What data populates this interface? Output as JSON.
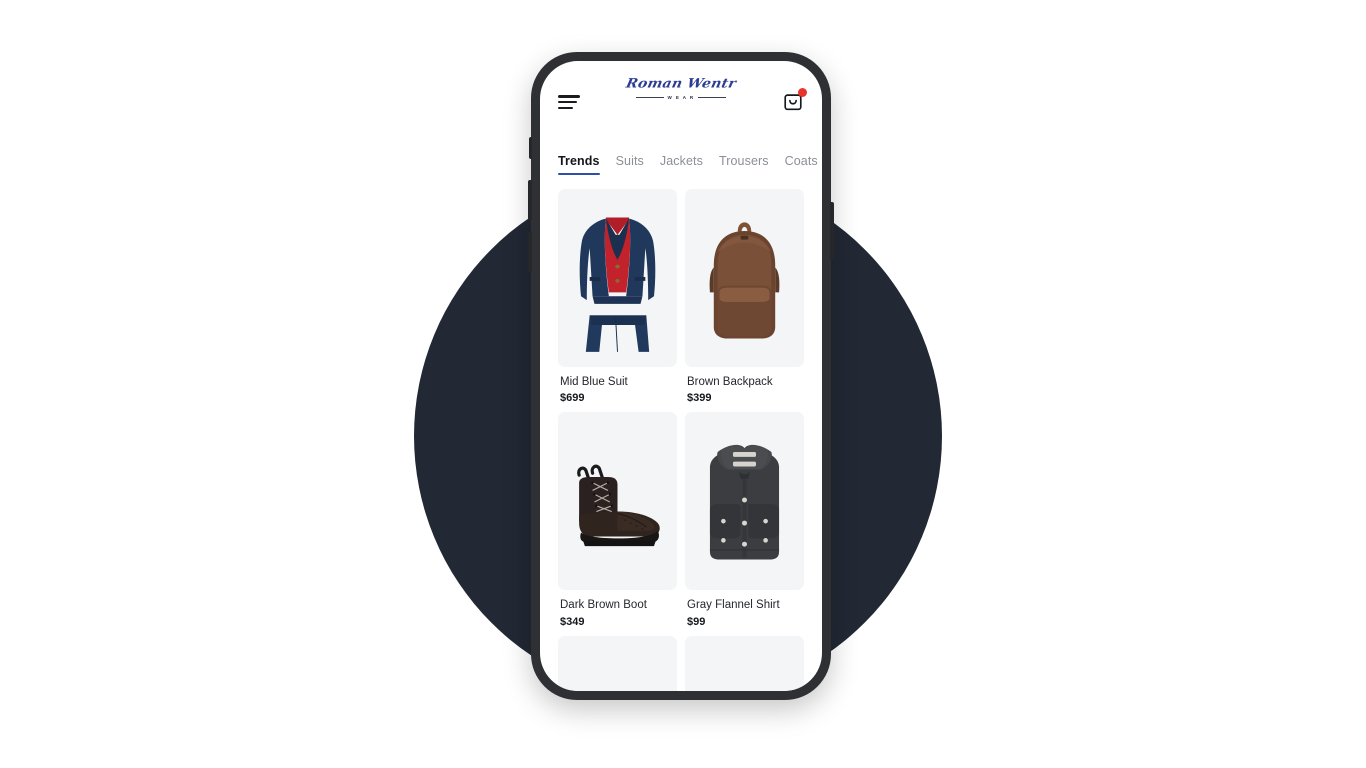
{
  "scene": {
    "background_color": "#ffffff",
    "circle_color": "#222834",
    "device_frame_color": "#2f3033",
    "screen_color": "#ffffff"
  },
  "app": {
    "brand": {
      "script_text": "Roman Wentr",
      "subtitle_text": "W E A R",
      "brand_color": "#2c3e94"
    },
    "header": {
      "menu_icon": "hamburger-menu-icon",
      "cart_icon": "shopping-bag-icon",
      "cart_badge_color": "#e8332a",
      "cart_has_notification": true
    },
    "tabs": [
      {
        "label": "Trends",
        "active": true
      },
      {
        "label": "Suits",
        "active": false
      },
      {
        "label": "Jackets",
        "active": false
      },
      {
        "label": "Trousers",
        "active": false
      },
      {
        "label": "Coats",
        "active": false
      }
    ],
    "active_tab_underline_color": "#2c4fa8",
    "products": [
      {
        "name": "Mid Blue Suit",
        "price": "$699",
        "art": "suit"
      },
      {
        "name": "Brown Backpack",
        "price": "$399",
        "art": "backpack"
      },
      {
        "name": "Dark Brown Boot",
        "price": "$349",
        "art": "boot"
      },
      {
        "name": "Gray Flannel Shirt",
        "price": "$99",
        "art": "shirt"
      },
      {
        "name": "",
        "price": "",
        "art": "tanbag"
      },
      {
        "name": "",
        "price": "",
        "art": "navyjacket"
      }
    ]
  }
}
